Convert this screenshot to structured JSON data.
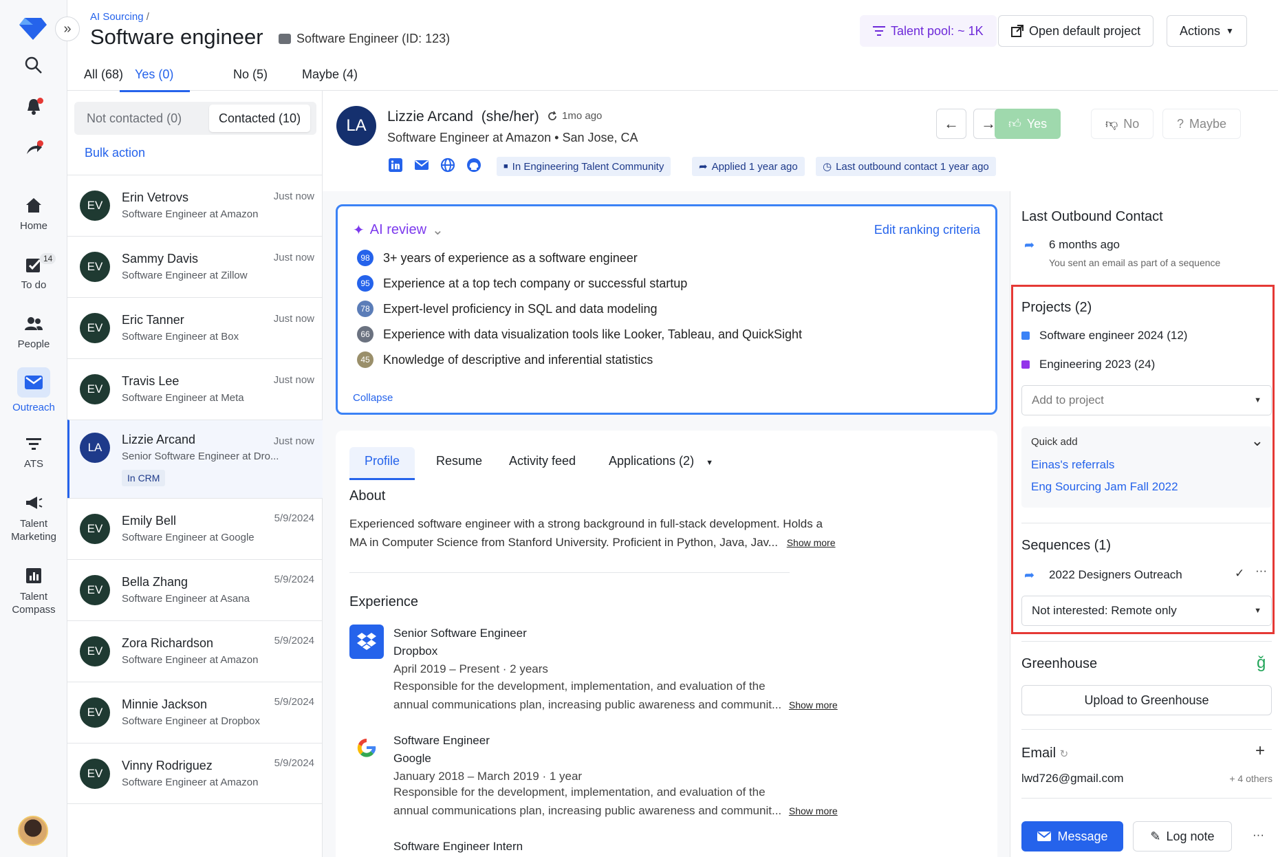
{
  "nav": {
    "expand": "»",
    "items": [
      {
        "name": "search",
        "label": ""
      },
      {
        "name": "notifications",
        "label": ""
      },
      {
        "name": "activity",
        "label": ""
      },
      {
        "name": "home",
        "label": "Home"
      },
      {
        "name": "todo",
        "label": "To do",
        "badge": "14"
      },
      {
        "name": "people",
        "label": "People"
      },
      {
        "name": "outreach",
        "label": "Outreach"
      },
      {
        "name": "ats",
        "label": "ATS"
      },
      {
        "name": "talent-marketing",
        "label": "Talent Marketing"
      },
      {
        "name": "talent-compass",
        "label": "Talent Compass"
      }
    ]
  },
  "header": {
    "breadcrumb": "AI Sourcing",
    "breadcrumb_sep": "/",
    "title": "Software engineer",
    "job_tag": "Software Engineer (ID: 123)",
    "talent_pool": "Talent pool: ~ 1K",
    "open_project": "Open default project",
    "actions": "Actions"
  },
  "tabs": [
    "All (68)",
    "Yes (0)",
    "No (5)",
    "Maybe (4)"
  ],
  "list": {
    "seg": [
      "Not contacted (0)",
      "Contacted (10)"
    ],
    "bulk_action": "Bulk action",
    "candidates": [
      {
        "initials": "EV",
        "name": "Erin Vetrovs",
        "sub": "Software Engineer at Amazon",
        "time": "Just now"
      },
      {
        "initials": "EV",
        "name": "Sammy Davis",
        "sub": "Software Engineer at Zillow",
        "time": "Just now"
      },
      {
        "initials": "EV",
        "name": "Eric Tanner",
        "sub": "Software Engineer at Box",
        "time": "Just now"
      },
      {
        "initials": "EV",
        "name": "Travis Lee",
        "sub": "Software Engineer at Meta",
        "time": "Just now"
      },
      {
        "initials": "LA",
        "name": "Lizzie Arcand",
        "sub": "Senior Software Engineer at Dro...",
        "time": "Just now",
        "tag": "In CRM"
      },
      {
        "initials": "EV",
        "name": "Emily Bell",
        "sub": "Software Engineer at Google",
        "time": "5/9/2024"
      },
      {
        "initials": "EV",
        "name": "Bella Zhang",
        "sub": "Software Engineer at Asana",
        "time": "5/9/2024"
      },
      {
        "initials": "EV",
        "name": "Zora Richardson",
        "sub": "Software Engineer at Amazon",
        "time": "5/9/2024"
      },
      {
        "initials": "EV",
        "name": "Minnie Jackson",
        "sub": "Software Engineer at Dropbox",
        "time": "5/9/2024"
      },
      {
        "initials": "EV",
        "name": "Vinny Rodriguez",
        "sub": "Software Engineer at Amazon",
        "time": "5/9/2024"
      }
    ]
  },
  "profile": {
    "initials": "LA",
    "name": "Lizzie Arcand",
    "pronouns": "(she/her)",
    "ago": "1mo ago",
    "role": "Software Engineer at Amazon",
    "location": "San Jose, CA",
    "chips": [
      "In Engineering Talent Community",
      "Applied 1 year ago",
      "Last outbound contact 1 year ago"
    ],
    "yes": "Yes",
    "no": "No",
    "maybe": "Maybe"
  },
  "ai_review": {
    "title": "AI review",
    "edit": "Edit ranking criteria",
    "collapse": "Collapse",
    "criteria": [
      {
        "score": "98",
        "text": "3+ years of experience as a software engineer",
        "color": "#2563eb"
      },
      {
        "score": "95",
        "text": "Experience at a top tech company or successful startup",
        "color": "#2563eb"
      },
      {
        "score": "78",
        "text": "Expert-level proficiency in SQL and data modeling",
        "color": "#5b7db8"
      },
      {
        "score": "66",
        "text": "Experience with data visualization tools like Looker, Tableau, and QuickSight",
        "color": "#6b7280"
      },
      {
        "score": "45",
        "text": "Knowledge of descriptive and inferential statistics",
        "color": "#9a8f6a"
      }
    ]
  },
  "profile_tabs": [
    "Profile",
    "Resume",
    "Activity feed",
    "Applications (2)"
  ],
  "about": {
    "heading": "About",
    "line1": "Experienced software engineer with a strong background in full-stack development. Holds a",
    "line2": "MA in Computer Science from Stanford University. Proficient in Python, Java, Jav...",
    "show_more": "Show more"
  },
  "experience": {
    "heading": "Experience",
    "items": [
      {
        "title": "Senior Software Engineer",
        "company": "Dropbox",
        "dates": "April 2019 – Present",
        "duration": "· 2 years",
        "desc1": "Responsible for the development, implementation, and evaluation of the",
        "desc2": "annual communications plan, increasing public awareness and communit...",
        "show_more": "Show more"
      },
      {
        "title": "Software Engineer",
        "company": "Google",
        "dates": "January 2018 – March 2019",
        "duration": "· 1 year",
        "desc1": "Responsible for the development, implementation, and evaluation of the",
        "desc2": "annual communications plan, increasing public awareness and communit...",
        "show_more": "Show more"
      },
      {
        "title": "Software Engineer Intern"
      }
    ]
  },
  "right": {
    "last_outbound": {
      "heading": "Last Outbound Contact",
      "when": "6 months ago",
      "note": "You sent an email as part of a sequence"
    },
    "projects": {
      "heading": "Projects (2)",
      "items": [
        {
          "label": "Software engineer 2024 (12)",
          "color": "#3b82f6"
        },
        {
          "label": "Engineering 2023 (24)",
          "color": "#9333ea"
        }
      ],
      "add_placeholder": "Add to project",
      "quick_add": "Quick add",
      "quick_links": [
        "Einas's referrals",
        "Eng Sourcing Jam Fall 2022"
      ]
    },
    "sequences": {
      "heading": "Sequences (1)",
      "item": "2022 Designers Outreach",
      "status": "Not interested: Remote only"
    },
    "greenhouse": {
      "heading": "Greenhouse",
      "upload": "Upload to Greenhouse"
    },
    "email": {
      "heading": "Email",
      "value": "lwd726@gmail.com",
      "others": "+ 4 others"
    },
    "actions": {
      "message": "Message",
      "log_note": "Log note"
    }
  }
}
